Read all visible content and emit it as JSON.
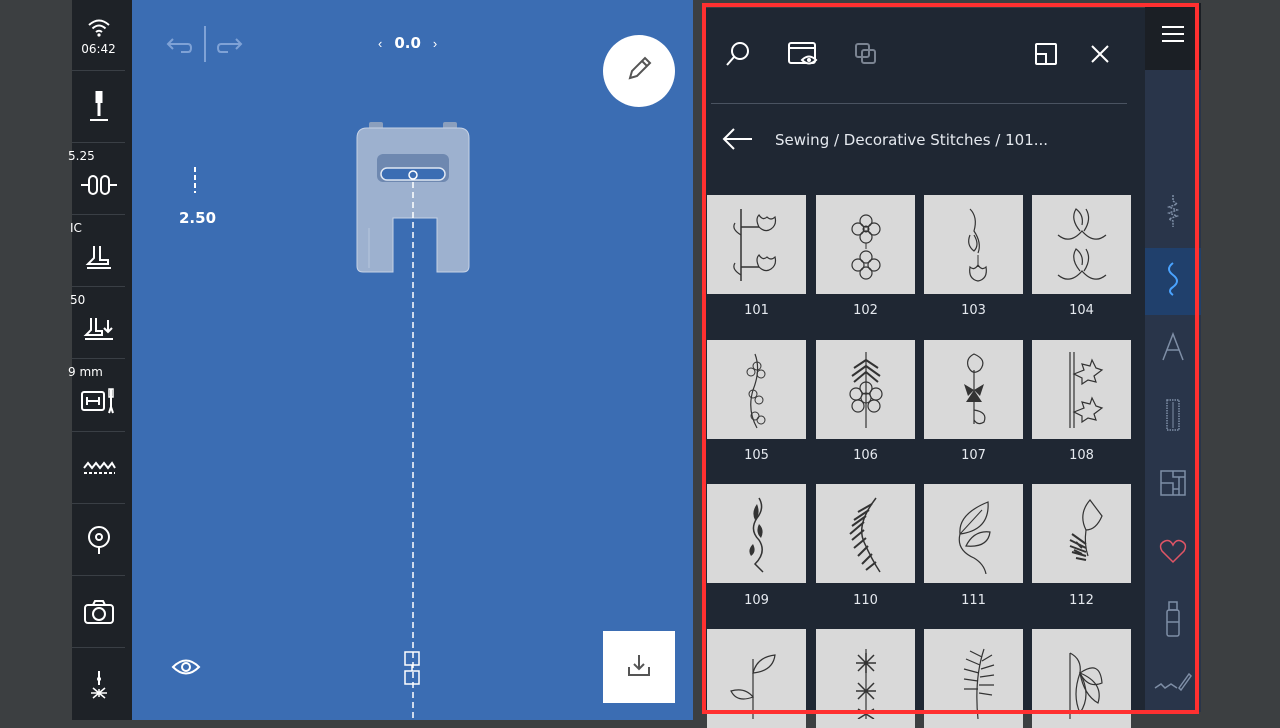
{
  "status": {
    "time": "06:42"
  },
  "left_bar": {
    "stitch_width_value": "5.25",
    "foot_value": "IC",
    "foot_pressure_value": "50",
    "needle_plate_value": "9 mm"
  },
  "canvas": {
    "offset_value": "0.0",
    "stitch_length_value": "2.50"
  },
  "panel": {
    "breadcrumb": "Sewing / Decorative Stitches / 101...",
    "stitches": [
      {
        "label": "101"
      },
      {
        "label": "102"
      },
      {
        "label": "103"
      },
      {
        "label": "104"
      },
      {
        "label": "105"
      },
      {
        "label": "106"
      },
      {
        "label": "107"
      },
      {
        "label": "108"
      },
      {
        "label": "109"
      },
      {
        "label": "110"
      },
      {
        "label": "111"
      },
      {
        "label": "112"
      },
      {
        "label": ""
      },
      {
        "label": ""
      },
      {
        "label": ""
      },
      {
        "label": ""
      }
    ]
  },
  "rail": {
    "items": [
      "utility-stitches-icon",
      "decorative-stitches-icon",
      "alphabet-icon",
      "buttonhole-icon",
      "quilt-icon",
      "favorites-icon",
      "bobbin-icon",
      "personal-program-icon"
    ]
  },
  "colors": {
    "canvas": "#3b6db3",
    "panel": "#1f2733",
    "highlight_outline": "#ff3030",
    "active_rail": "#4aa3ff"
  }
}
